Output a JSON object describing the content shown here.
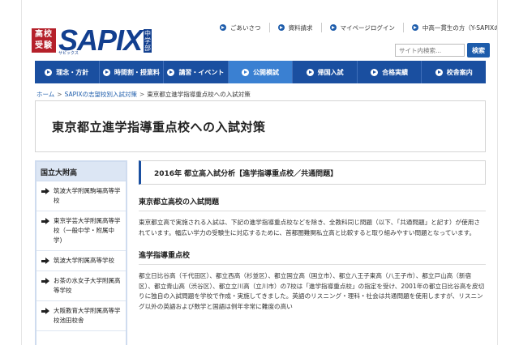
{
  "header": {
    "logo_badge": "高校受験",
    "logo_brand": "SAPIX",
    "logo_vertical": "中学部",
    "logo_sub": "サピックス"
  },
  "toplinks": [
    {
      "label": "ごあいさつ"
    },
    {
      "label": "資料請求"
    },
    {
      "label": "マイページログイン"
    },
    {
      "label": "中高一貫生の方（Y-SAPIXのご案内)"
    }
  ],
  "search": {
    "placeholder": "サイト内検索...",
    "button_label": "検索"
  },
  "nav": {
    "items": [
      {
        "label": "理念・方針"
      },
      {
        "label": "時間割・授業料"
      },
      {
        "label": "講習・イベント"
      },
      {
        "label": "公開模試"
      },
      {
        "label": "帰国入試"
      },
      {
        "label": "合格実績"
      },
      {
        "label": "校舎案内"
      }
    ]
  },
  "breadcrumb": {
    "home": "ホーム",
    "parent": "SAPIXの志望校別入試対策",
    "current": "東京都立進学指導重点校への入試対策",
    "separator": ">"
  },
  "page": {
    "title": "東京都立進学指導重点校への入試対策"
  },
  "sidebar": {
    "heading": "国立大附高",
    "items": [
      {
        "label": "筑波大学附属駒場高等学校"
      },
      {
        "label": "東京学芸大学附属高等学校（一般中学・附属中学)"
      },
      {
        "label": "筑波大学附属高等学校"
      },
      {
        "label": "お茶の水女子大学附属高等学校"
      },
      {
        "label": "大阪教育大学附属高等学校池田校舎"
      }
    ]
  },
  "main": {
    "section_header": "2016年 都立高入試分析【進学指導重点校／共通問題】",
    "heading_1": "東京都立高校の入試問題",
    "paragraph_1": "東京都立高で実施される入試は、下記の進学指導重点校などを除き、全教科同じ問題（以下、「共通問題」と記す）が使用されています。幅広い学力の受験生に対応するために、首都圏難関私立高と比較すると取り組みやすい問題となっています。",
    "heading_2": "進学指導重点校",
    "paragraph_2": "都立日比谷高（千代田区）、都立西高（杉並区）、都立国立高（国立市）、都立八王子東高（八王子市）、都立戸山高（新宿区）、都立青山高（渋谷区）、都立立川高（立川市）の7校は「進学指導重点校」の指定を受け、2001年の都立日比谷高を皮切りに独自の入試問題を学校で作成・実施してきました。英語のリスニング・理科・社会は共通問題を使用しますが、リスニング以外の英語および数学と国語は例年非常に難度の高い"
  },
  "colors": {
    "nav_bg": "#1a4fa0",
    "nav_active": "#3a80d2",
    "logo_red": "#b5202a",
    "brand_blue": "#123f8f",
    "sidebar_head_bg": "#dce6f4"
  },
  "icons": {
    "toplink": "arrow-circle-icon",
    "nav": "arrow-circle-icon",
    "sidebar": "arrow-right-icon"
  }
}
